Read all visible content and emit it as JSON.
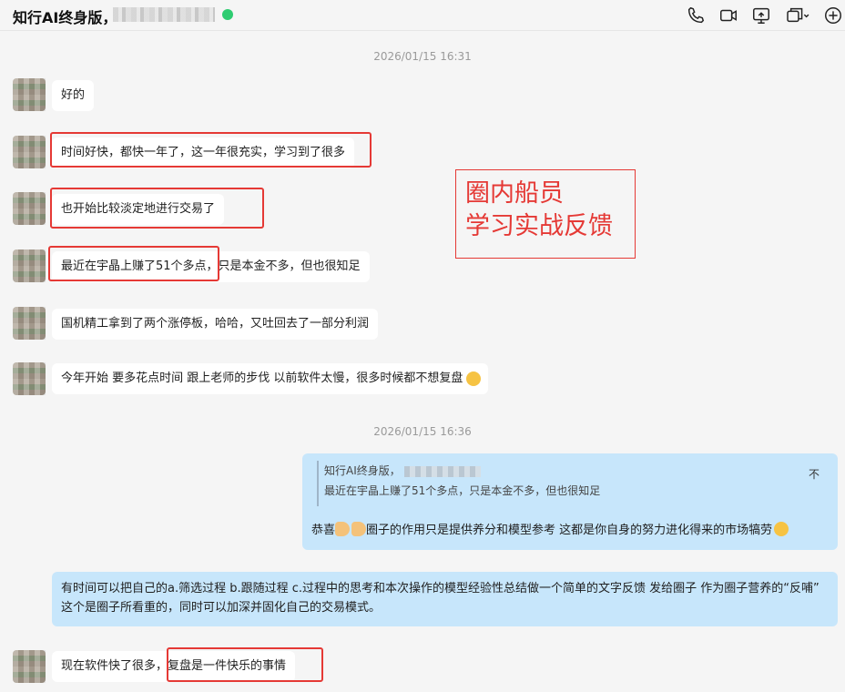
{
  "header": {
    "title": "知行AI终身版，",
    "icons": [
      "phone-icon",
      "video-icon",
      "screen-share-icon",
      "multi-window-icon",
      "add-icon"
    ]
  },
  "timestamps": [
    "2026/01/15 16:31",
    "2026/01/15 16:36"
  ],
  "messages": [
    {
      "text": "好的"
    },
    {
      "text": "时间好快，都快一年了，这一年很充实，学习到了很多"
    },
    {
      "text": "也开始比较淡定地进行交易了"
    },
    {
      "text": "最近在宇晶上赚了51个多点，只是本金不多，但也很知足"
    },
    {
      "text": "国机精工拿到了两个涨停板，哈哈，又吐回去了一部分利润"
    },
    {
      "text": "今年开始 要多花点时间 跟上老师的步伐 以前软件太慢，很多时候都不想复盘"
    },
    {
      "text": "现在软件快了很多，复盘是一件快乐的事情"
    }
  ],
  "overlay": {
    "line1": "圈内船员",
    "line2": "学习实战反馈"
  },
  "reply": {
    "quote_name": "知行AI终身版，",
    "quote_text": "最近在宇晶上赚了51个多点，只是本金不多，但也很知足",
    "collapse": "不",
    "text_pre": "恭喜",
    "text_post": "圈子的作用只是提供养分和模型参考 这都是你自身的努力进化得来的市场犒劳"
  },
  "advice": {
    "text": "有时间可以把自己的a.筛选过程 b.跟随过程 c.过程中的思考和本次操作的模型经验性总结做一个简单的文字反馈 发给圈子 作为圈子营养的“反哺” 这个是圈子所看重的，同时可以加深并固化自己的交易模式。"
  },
  "colors": {
    "highlight": "#e53935",
    "bubble_blue": "#c7e6fb",
    "online": "#2ecc71"
  }
}
